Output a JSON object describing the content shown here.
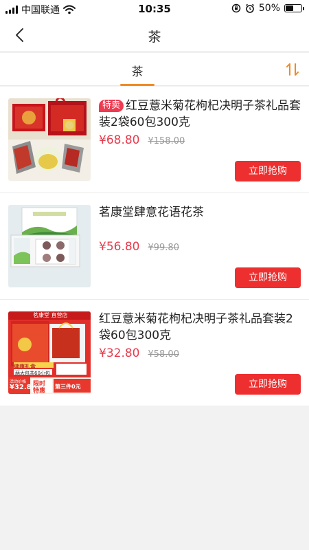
{
  "status_bar": {
    "carrier": "中国联通",
    "time": "10:35",
    "battery_text": "50%",
    "battery_level": 0.5,
    "icons": [
      "signal-icon",
      "wifi-icon",
      "rotation-lock-icon",
      "alarm-icon",
      "battery-icon"
    ]
  },
  "nav": {
    "title": "茶",
    "back_icon": "chevron-left-icon"
  },
  "tabs": {
    "active_label": "茶",
    "sort_icon": "sort-arrows-icon",
    "accent_color": "#f08a24"
  },
  "colors": {
    "price": "#e63b4c",
    "button": "#ee2f2f",
    "badge": "#ee3b52"
  },
  "products": [
    {
      "badge": "特卖",
      "title": "红豆薏米菊花枸杞决明子茶礼品套装2袋60包300克",
      "price": "¥68.80",
      "original_price": "¥158.00",
      "button_label": "立即抢购"
    },
    {
      "badge": "",
      "title": "茗康堂肆意花语花茶",
      "price": "¥56.80",
      "original_price": "¥99.80",
      "button_label": "立即抢购"
    },
    {
      "badge": "",
      "title": "红豆薏米菊花枸杞决明子茶礼品套装2袋60包300克",
      "price": "¥32.80",
      "original_price": "¥58.00",
      "button_label": "立即抢购",
      "image_text": {
        "shop": "茗康堂 直营店",
        "gift": "健康礼盒",
        "desc": "两大包共60小包",
        "promo_label": "活动价格",
        "promo_price": "¥32.8",
        "limited": "限时特惠",
        "third_item": "第三件0元"
      }
    }
  ]
}
